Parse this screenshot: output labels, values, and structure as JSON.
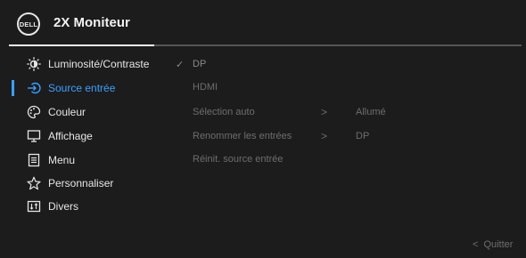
{
  "header": {
    "logo_text": "DELL",
    "title": "2X Moniteur"
  },
  "sidebar": {
    "items": [
      {
        "label": "Luminosité/Contraste",
        "icon": "brightness-icon"
      },
      {
        "label": "Source entrée",
        "icon": "input-source-icon",
        "active": true
      },
      {
        "label": "Couleur",
        "icon": "palette-icon"
      },
      {
        "label": "Affichage",
        "icon": "display-icon"
      },
      {
        "label": "Menu",
        "icon": "menu-list-icon"
      },
      {
        "label": "Personnaliser",
        "icon": "star-icon"
      },
      {
        "label": "Divers",
        "icon": "other-settings-icon"
      }
    ]
  },
  "options": {
    "items": [
      {
        "label": "DP",
        "checked": true
      },
      {
        "label": "HDMI"
      },
      {
        "label": "Sélection auto",
        "value": "Allumé"
      },
      {
        "label": "Renommer les entrées",
        "value": "DP"
      },
      {
        "label": "Réinit. source entrée"
      }
    ],
    "check_mark": "✓",
    "chevron": ">"
  },
  "footer": {
    "back_glyph": "<",
    "quit_label": "Quitter"
  },
  "colors": {
    "background": "#1c1c1c",
    "accent": "#3aa0ff",
    "text": "#e6e6e6",
    "dim_text": "#6e6e6e"
  }
}
